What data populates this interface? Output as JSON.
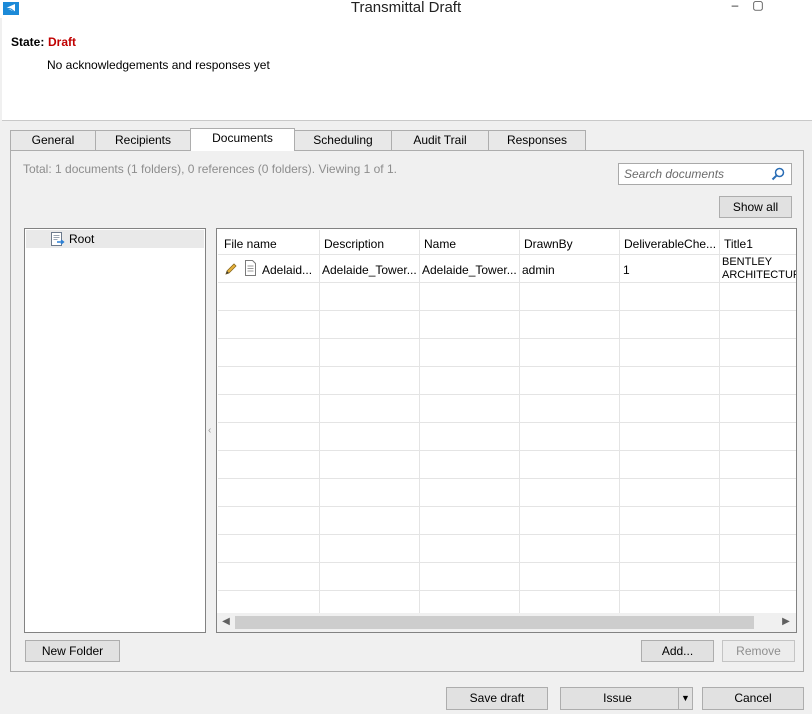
{
  "window": {
    "title": "Transmittal Draft",
    "minimize_glyph": "–",
    "maximize_glyph": "▢"
  },
  "header": {
    "state_label": "State:",
    "state_value": "Draft",
    "ack_text": "No acknowledgements and responses yet"
  },
  "tabs": [
    {
      "label": "General",
      "active": false
    },
    {
      "label": "Recipients",
      "active": false
    },
    {
      "label": "Documents",
      "active": true
    },
    {
      "label": "Scheduling",
      "active": false
    },
    {
      "label": "Audit Trail",
      "active": false
    },
    {
      "label": "Responses",
      "active": false
    }
  ],
  "documents": {
    "summary": "Total: 1 documents (1 folders), 0 references (0 folders). Viewing 1 of 1.",
    "search_placeholder": "Search documents",
    "show_all_label": "Show all",
    "tree": {
      "root_label": "Root"
    },
    "columns": [
      "File name",
      "Description",
      "Name",
      "DrawnBy",
      "DeliverableChe...",
      "Title1"
    ],
    "rows": [
      {
        "file_name": "Adelaid...",
        "description": "Adelaide_Tower...",
        "name": "Adelaide_Tower...",
        "drawn_by": "admin",
        "deliverable": "1",
        "title1_line1": "BENTLEY",
        "title1_line2": "ARCHITECTUR..."
      }
    ],
    "new_folder_label": "New Folder",
    "add_label": "Add...",
    "remove_label": "Remove"
  },
  "footer": {
    "save_draft_label": "Save draft",
    "issue_label": "Issue",
    "cancel_label": "Cancel"
  },
  "colors": {
    "state_draft": "#c00000",
    "app_icon": "#1c8ad8"
  }
}
